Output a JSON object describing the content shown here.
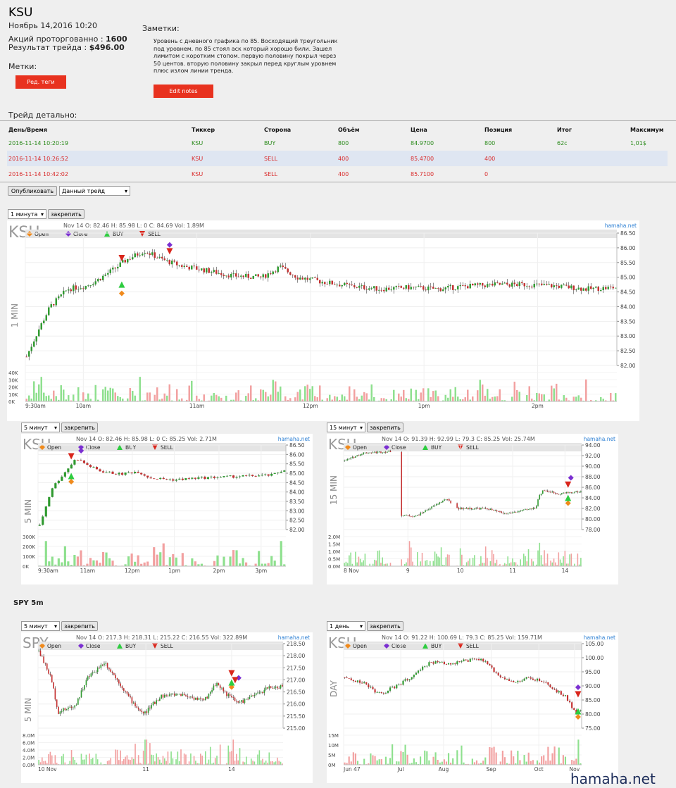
{
  "header": {
    "ticker": "KSU",
    "datetime": "Ноябрь 14,2016 10:20",
    "shares_label": "Акций проторгованно :",
    "shares_value": "1600",
    "result_label": "Результат трейда :",
    "result_value": "$496.00",
    "tags_label": "Метки:",
    "edit_tags": "Ред. теги"
  },
  "notes": {
    "label": "Заметки:",
    "text": "Уровень с дневного графика по 85. Восходящий треугольник под уровнем. по 85 стоял аск который хорошо били. Зашел лимитом с коротким стопом. первую половину покрыл через 50 центов. вторую половину закрыл перед круглым уровнем плюс излом линии тренда.",
    "edit": "Edit notes"
  },
  "trade": {
    "title": "Трейд детально:",
    "columns": [
      "День/Время",
      "Тиккер",
      "Сторона",
      "Объём",
      "Цена",
      "Позиция",
      "Итог",
      "Максимум"
    ],
    "rows": [
      [
        "2016-11-14 10:20:19",
        "KSU",
        "BUY",
        "800",
        "84.9700",
        "800",
        "62c",
        "1,01$"
      ],
      [
        "2016-11-14 10:26:52",
        "KSU",
        "SELL",
        "400",
        "85.4700",
        "400",
        "",
        ""
      ],
      [
        "2016-11-14 10:42:02",
        "KSU",
        "SELL",
        "400",
        "85.7100",
        "0",
        "",
        ""
      ]
    ]
  },
  "controls": {
    "publish": "Опубликовать",
    "filter": "Данный трейд",
    "pin": "закрепить"
  },
  "legend": {
    "open": "Open",
    "close": "Close",
    "buy": "BUY",
    "sell": "SELL"
  },
  "source": "hamaha.net",
  "spy_title": "SPY 5m",
  "watermark": "hamaha.net",
  "colors": {
    "up": "#2f9a2f",
    "down": "#c43030",
    "vol_up": "#8ee08e",
    "vol_down": "#f2a0a0",
    "buy": "#2ecc40",
    "sell": "#d9261c",
    "open": "#f08a1c",
    "close": "#7b2fd1",
    "accent": "#e8321f"
  },
  "chart_data": [
    {
      "name": "c1",
      "type": "candlestick",
      "ticker": "KSU",
      "tf_select": "1 минута",
      "side_label": "1 MIN",
      "info": "Nov 14 O: 82.46 H: 85.98 L: 0 C: 84.69   Vol: 1.89M",
      "ylim": [
        82,
        86.5
      ],
      "yticks": [
        "86.50",
        "86.00",
        "85.50",
        "85.00",
        "84.50",
        "84.00",
        "83.50",
        "83.00",
        "82.50",
        "82.00"
      ],
      "vticks": [
        "40K",
        "30K",
        "20K",
        "10K",
        "0K"
      ],
      "xticks": [
        "9:30am",
        "10am",
        "11am",
        "12pm",
        "1pm",
        "2pm"
      ],
      "price_path": [
        [
          0,
          82.3
        ],
        [
          0.02,
          83.2
        ],
        [
          0.04,
          84.0
        ],
        [
          0.07,
          84.6
        ],
        [
          0.1,
          84.7
        ],
        [
          0.12,
          84.9
        ],
        [
          0.15,
          85.3
        ],
        [
          0.17,
          85.6
        ],
        [
          0.2,
          85.9
        ],
        [
          0.23,
          85.6
        ],
        [
          0.26,
          85.4
        ],
        [
          0.3,
          85.25
        ],
        [
          0.35,
          85.05
        ],
        [
          0.4,
          85.0
        ],
        [
          0.43,
          85.35
        ],
        [
          0.46,
          85.0
        ],
        [
          0.5,
          84.85
        ],
        [
          0.55,
          84.7
        ],
        [
          0.6,
          84.6
        ],
        [
          0.65,
          84.65
        ],
        [
          0.7,
          84.6
        ],
        [
          0.75,
          84.7
        ],
        [
          0.8,
          84.75
        ],
        [
          0.85,
          84.75
        ],
        [
          0.9,
          84.7
        ],
        [
          0.95,
          84.6
        ],
        [
          1,
          84.65
        ]
      ],
      "markers": {
        "open": [
          84.45
        ],
        "close": [
          86.1
        ],
        "buy": [
          84.75
        ],
        "sell": [
          85.65,
          85.88
        ]
      }
    },
    {
      "name": "c2",
      "type": "candlestick",
      "ticker": "KSU",
      "tf_select": "5 минут",
      "side_label": "5 MIN",
      "info": "Nov 14 O: 82.46 H: 85.98 L: 0 C: 85.25   Vol: 2.71M",
      "ylim": [
        82,
        86.5
      ],
      "yticks": [
        "86.50",
        "86.00",
        "85.50",
        "85.00",
        "84.50",
        "84.00",
        "83.50",
        "83.00",
        "82.50",
        "82.00"
      ],
      "vticks": [
        "300K",
        "200K",
        "100K",
        "0K"
      ],
      "xticks": [
        "9:30am",
        "11am",
        "12pm",
        "1pm",
        "2pm",
        "3pm"
      ],
      "price_path": [
        [
          0,
          82.2
        ],
        [
          0.05,
          84.2
        ],
        [
          0.1,
          85.0
        ],
        [
          0.15,
          85.8
        ],
        [
          0.2,
          85.4
        ],
        [
          0.25,
          85.1
        ],
        [
          0.33,
          84.95
        ],
        [
          0.4,
          85.1
        ],
        [
          0.45,
          84.75
        ],
        [
          0.55,
          84.65
        ],
        [
          0.65,
          84.75
        ],
        [
          0.75,
          84.8
        ],
        [
          0.85,
          84.85
        ],
        [
          0.95,
          84.9
        ],
        [
          1,
          85.2
        ]
      ],
      "markers": {
        "open": [
          84.55
        ],
        "close": [
          86.2
        ],
        "buy": [
          84.85
        ],
        "sell": [
          85.9
        ]
      }
    },
    {
      "name": "c3",
      "type": "candlestick",
      "ticker": "KSU",
      "tf_select": "15 минут",
      "side_label": "15 MIN",
      "info": "Nov 14 O: 91.39 H: 92.99 L: 79.3 C: 85.25   Vol: 25.74M",
      "ylim": [
        78,
        94
      ],
      "yticks": [
        "94.00",
        "92.00",
        "90.00",
        "88.00",
        "86.00",
        "84.00",
        "82.00",
        "80.00",
        "78.00"
      ],
      "vticks": [
        "2.0M",
        "1.5M",
        "1.0M",
        "0.5M",
        "0.0M"
      ],
      "xticks": [
        "8 Nov",
        "9",
        "10",
        "11",
        "14"
      ],
      "price_path": [
        [
          0,
          91
        ],
        [
          0.08,
          92.5
        ],
        [
          0.2,
          92.8
        ],
        [
          0.22,
          80.8
        ],
        [
          0.3,
          80.5
        ],
        [
          0.38,
          82.5
        ],
        [
          0.43,
          83.8
        ],
        [
          0.48,
          82
        ],
        [
          0.6,
          82
        ],
        [
          0.68,
          81
        ],
        [
          0.78,
          81.8
        ],
        [
          0.81,
          82.2
        ],
        [
          0.82,
          84
        ],
        [
          0.84,
          85.5
        ],
        [
          0.9,
          84.8
        ],
        [
          1,
          85.2
        ]
      ],
      "markers": {
        "open": [
          83
        ],
        "close": [
          87.8
        ],
        "buy": [
          84
        ],
        "sell": [
          86.5
        ]
      }
    },
    {
      "name": "c4",
      "type": "candlestick",
      "ticker": "SPY",
      "tf_select": "5 минут",
      "side_label": "5 MIN",
      "info": "Nov 14 O: 217.3 H: 218.31 L: 215.22 C: 216.55   Vol: 322.89M",
      "ylim": [
        214.8,
        218.5
      ],
      "yticks": [
        "218.50",
        "218.00",
        "217.50",
        "217.00",
        "216.50",
        "216.00",
        "215.50",
        "215.00"
      ],
      "vticks": [
        "8.0M",
        "6.0M",
        "4.0M",
        "2.0M",
        "0.0M"
      ],
      "xticks": [
        "10 Nov",
        "11",
        "14"
      ],
      "price_path": [
        [
          0,
          218.2
        ],
        [
          0.05,
          217.0
        ],
        [
          0.08,
          215.5
        ],
        [
          0.15,
          215.8
        ],
        [
          0.2,
          217.0
        ],
        [
          0.27,
          217.7
        ],
        [
          0.33,
          216.8
        ],
        [
          0.38,
          216.0
        ],
        [
          0.43,
          215.4
        ],
        [
          0.5,
          216.2
        ],
        [
          0.58,
          216.3
        ],
        [
          0.68,
          216.0
        ],
        [
          0.73,
          216.8
        ],
        [
          0.77,
          216.3
        ],
        [
          0.82,
          215.9
        ],
        [
          0.88,
          216.2
        ],
        [
          0.95,
          216.6
        ],
        [
          1,
          216.6
        ]
      ],
      "markers": {
        "open": [
          216.6
        ],
        "close": [
          217.0
        ],
        "buy": [
          216.8
        ],
        "sell": [
          217.2,
          216.9
        ]
      }
    },
    {
      "name": "c5",
      "type": "candlestick",
      "ticker": "KSU",
      "tf_select": "1 день",
      "side_label": "DAY",
      "info": "Nov 14 O: 91.22 H: 100.69 L: 79.3 C: 85.25   Vol: 159.71M",
      "ylim": [
        75,
        105
      ],
      "yticks": [
        "105.00",
        "100.00",
        "95.00",
        "90.00",
        "85.00",
        "80.00",
        "75.00"
      ],
      "vticks": [
        "15M",
        "10M",
        "5M",
        "0M"
      ],
      "xticks": [
        "Jun 47",
        "Jul",
        "Aug",
        "Sep",
        "Oct",
        "Nov"
      ],
      "price_path": [
        [
          0,
          93
        ],
        [
          0.08,
          91
        ],
        [
          0.15,
          87
        ],
        [
          0.22,
          90
        ],
        [
          0.3,
          94
        ],
        [
          0.36,
          98.5
        ],
        [
          0.45,
          98
        ],
        [
          0.52,
          99
        ],
        [
          0.58,
          99.5
        ],
        [
          0.65,
          94
        ],
        [
          0.72,
          91
        ],
        [
          0.78,
          93
        ],
        [
          0.85,
          91
        ],
        [
          0.9,
          88
        ],
        [
          0.94,
          86
        ],
        [
          0.96,
          83
        ],
        [
          0.98,
          80
        ],
        [
          1,
          81
        ]
      ],
      "markers": {
        "open": [
          79
        ],
        "close": [
          89.5
        ],
        "buy": [
          81
        ],
        "sell": [
          87
        ]
      }
    }
  ]
}
